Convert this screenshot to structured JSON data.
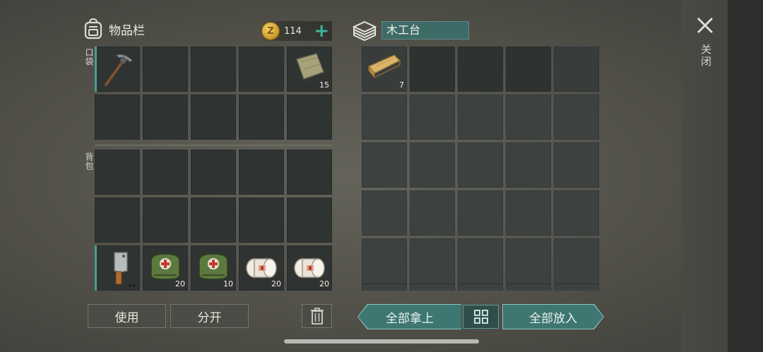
{
  "inventory": {
    "title": "物品栏",
    "icon": "backpack-icon",
    "coins": {
      "icon": "coin-icon",
      "count": "114",
      "add_label": "+"
    },
    "pocket_label": "口袋",
    "backpack_label": "背包",
    "slots": [
      {
        "item": "pickaxe",
        "qty": ""
      },
      {
        "item": "",
        "qty": ""
      },
      {
        "item": "",
        "qty": ""
      },
      {
        "item": "",
        "qty": ""
      },
      {
        "item": "cloth",
        "qty": "15"
      },
      {
        "item": "",
        "qty": ""
      },
      {
        "item": "",
        "qty": ""
      },
      {
        "item": "",
        "qty": ""
      },
      {
        "item": "",
        "qty": ""
      },
      {
        "item": "",
        "qty": ""
      },
      {
        "item": "",
        "qty": ""
      },
      {
        "item": "",
        "qty": ""
      },
      {
        "item": "",
        "qty": ""
      },
      {
        "item": "",
        "qty": ""
      },
      {
        "item": "",
        "qty": ""
      },
      {
        "item": "",
        "qty": ""
      },
      {
        "item": "",
        "qty": ""
      },
      {
        "item": "",
        "qty": ""
      },
      {
        "item": "",
        "qty": ""
      },
      {
        "item": "",
        "qty": ""
      },
      {
        "item": "cleaver",
        "qty": ""
      },
      {
        "item": "medkit",
        "qty": "20"
      },
      {
        "item": "medkit",
        "qty": "10"
      },
      {
        "item": "bandage",
        "qty": "20"
      },
      {
        "item": "bandage",
        "qty": "20"
      }
    ],
    "use_label": "使用",
    "split_label": "分开",
    "trash_icon": "trash-icon"
  },
  "bench": {
    "icon": "stacked-boards-icon",
    "name": "木工台",
    "slots_first": [
      {
        "item": "plank",
        "qty": "7"
      }
    ],
    "take_all_label": "全部拿上",
    "sort_icon": "grid-icon",
    "put_all_label": "全部放入"
  },
  "close": {
    "icon": "close-icon",
    "label": "关闭"
  },
  "colors": {
    "accent": "#3e7671",
    "coin": "#d8a431",
    "plus": "#3fb3a0"
  }
}
